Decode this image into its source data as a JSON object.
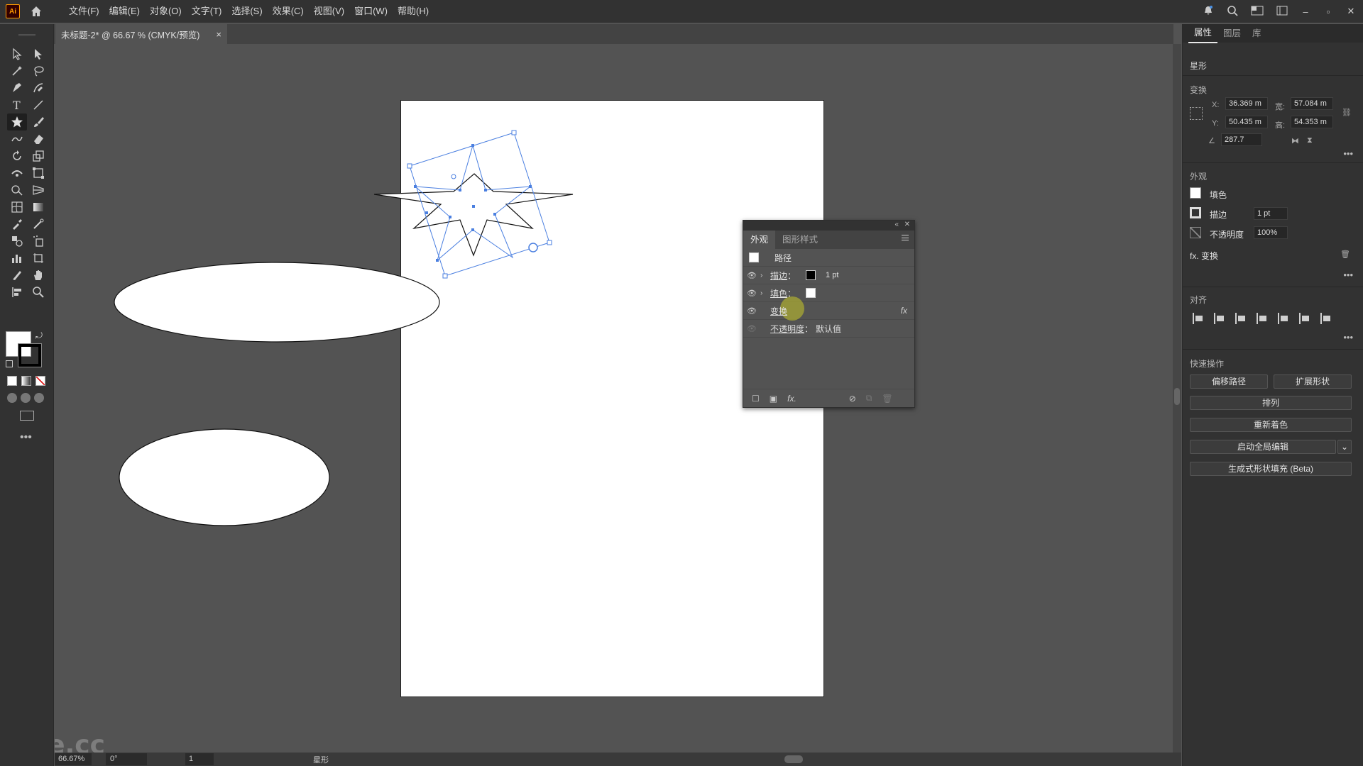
{
  "app": {
    "logo_text": "Ai"
  },
  "menu": [
    "文件(F)",
    "编辑(E)",
    "对象(O)",
    "文字(T)",
    "选择(S)",
    "效果(C)",
    "视图(V)",
    "窗口(W)",
    "帮助(H)"
  ],
  "document_tab": {
    "title": "未标题-2* @ 66.67 % (CMYK/预览)",
    "close": "×"
  },
  "appearance_panel": {
    "tabs": [
      "外观",
      "图形样式"
    ],
    "object_type": "路径",
    "rows": [
      {
        "label": "描边",
        "value": "1 pt",
        "swatch": "#000000"
      },
      {
        "label": "填色",
        "value": "",
        "swatch": "#ffffff"
      },
      {
        "label": "变换",
        "fx": "fx"
      },
      {
        "label": "不透明度",
        "value": "默认值"
      }
    ],
    "footer_fx": "fx."
  },
  "properties_panel": {
    "tabs": [
      "属性",
      "图层",
      "库"
    ],
    "object_name": "星形",
    "transform": {
      "title": "变换",
      "x_label": "X:",
      "x": "36.369 m",
      "y_label": "Y:",
      "y": "50.435 m",
      "w_label": "宽:",
      "w": "57.084 m",
      "h_label": "高:",
      "h": "54.353 m",
      "angle": "287.7"
    },
    "appearance": {
      "title": "外观",
      "fill": "填色",
      "stroke": "描边",
      "stroke_value": "1 pt",
      "opacity": "不透明度",
      "opacity_value": "100%",
      "fx_label": "fx. 变换"
    },
    "align": {
      "title": "对齐"
    },
    "quick_actions": {
      "title": "快速操作",
      "offset_path": "偏移路径",
      "expand_shape": "扩展形状",
      "arrange": "排列",
      "recolor": "重新着色",
      "global_edit": "启动全局编辑",
      "gen_fill": "生成式形状填充 (Beta)"
    }
  },
  "status": {
    "zoom": "66.67%",
    "rotation": "0°",
    "page": "1",
    "tool": "星形"
  },
  "watermark": "tafe.cc",
  "colors": {
    "selection": "#4a7fe0",
    "menubar": "#323232",
    "canvas": "#535353"
  }
}
